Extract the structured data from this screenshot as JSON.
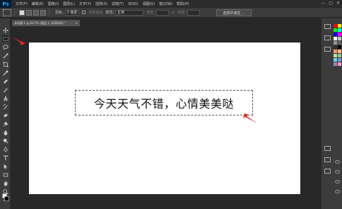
{
  "app": {
    "logo": "Ps"
  },
  "menu": [
    "文件(F)",
    "编辑(E)",
    "图像(I)",
    "图层(L)",
    "文字(Y)",
    "选择(S)",
    "滤镜(T)",
    "3D(D)",
    "视图(V)",
    "窗口(W)",
    "帮助(H)"
  ],
  "window_controls": {
    "minimize": "—",
    "restore": "□",
    "close": "✕"
  },
  "options": {
    "feather_label": "羽化:",
    "feather_value": "0 像素",
    "antialias_label": "消除锯齿",
    "style_label": "样式:",
    "style_value": "正常",
    "width_label": "宽度:",
    "height_label": "高度:",
    "refine_button": "选择并遮住 ..."
  },
  "document_tab": {
    "title": "未标题-1 @ 66.7% (图层 1, RGB/8#) *",
    "close": "×"
  },
  "canvas": {
    "text": "今天天气不错，心情美美哒"
  },
  "colors": {
    "foreground": "#ffffff",
    "background": "#000000",
    "arrow": "#e0261b",
    "swatches": [
      "#ff0000",
      "#ffff00",
      "#00ff00",
      "#00ffff",
      "#0000ff",
      "#ff00ff",
      "#ffffff",
      "#c8c8c8",
      "#969696",
      "#646464",
      "#323232",
      "#000000",
      "#f7977a",
      "#fdc68a",
      "#c4df9b",
      "#82ca9c",
      "#6dcff6",
      "#8493ca",
      "#a186be",
      "#f49ac1"
    ]
  }
}
